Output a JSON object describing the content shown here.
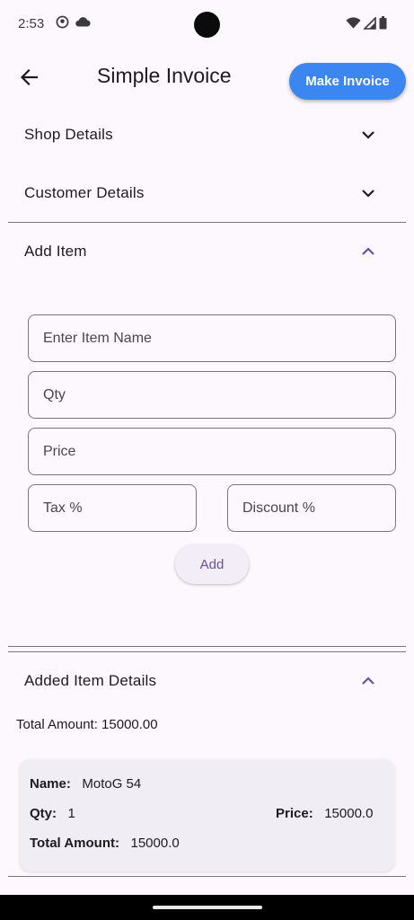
{
  "status_bar": {
    "time": "2:53"
  },
  "app_bar": {
    "title": "Simple Invoice",
    "make_invoice_label": "Make Invoice"
  },
  "sections": {
    "shop_details": "Shop Details",
    "customer_details": "Customer Details",
    "add_item": "Add Item",
    "added_item_details": "Added Item Details"
  },
  "form": {
    "item_name_placeholder": "Enter Item Name",
    "qty_placeholder": "Qty",
    "price_placeholder": "Price",
    "tax_placeholder": "Tax %",
    "discount_placeholder": "Discount %",
    "add_label": "Add"
  },
  "summary": {
    "total_amount_text": "Total Amount: 15000.00"
  },
  "items": [
    {
      "name_label": "Name:",
      "name": "MotoG 54",
      "qty_label": "Qty:",
      "qty": "1",
      "price_label": "Price:",
      "price": "15000.0",
      "total_label": "Total Amount:",
      "total": "15000.0"
    }
  ],
  "colors": {
    "primary_button": "#3b86f1",
    "accent": "#6750a4",
    "background": "#fdf8fd"
  },
  "icons": [
    "arrow-back-icon",
    "chevron-down-icon",
    "chevron-up-icon",
    "wifi-icon",
    "signal-icon",
    "battery-icon",
    "cloud-icon"
  ]
}
